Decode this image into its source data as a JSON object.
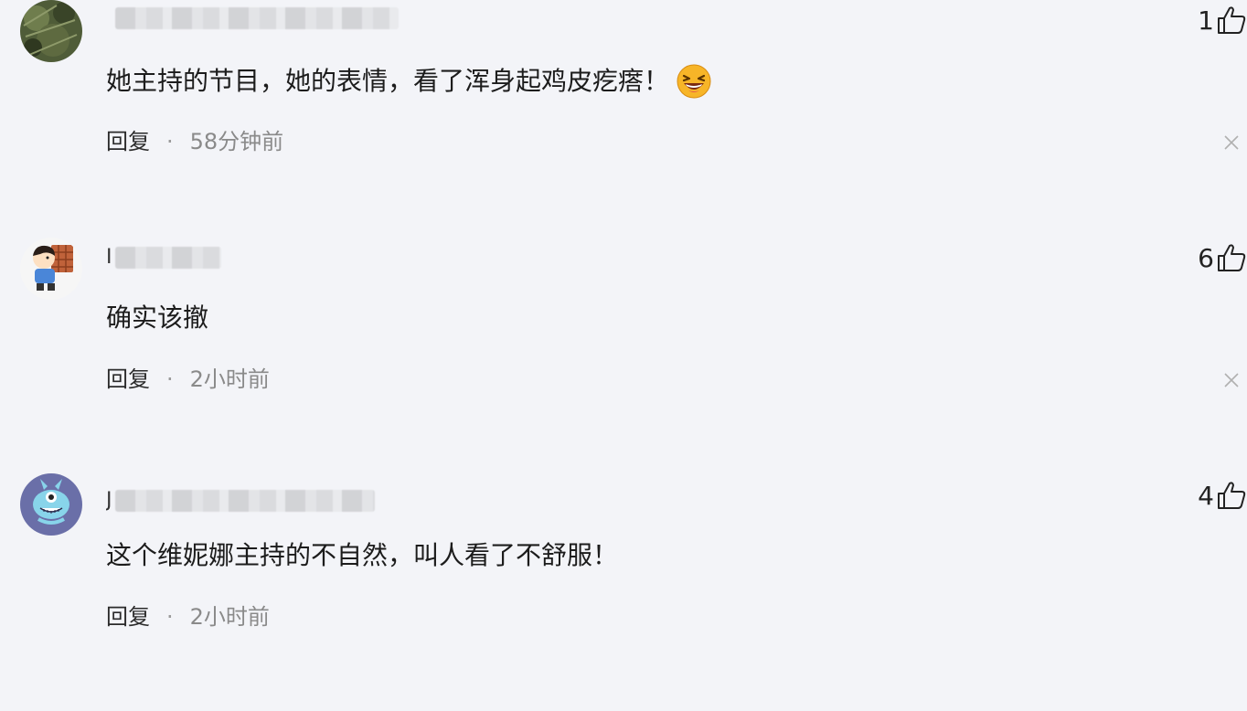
{
  "comments": [
    {
      "username_prefix": "",
      "text": "她主持的节目，她的表情，看了浑身起鸡皮疙瘩！",
      "emoji": "laughing-emoji",
      "reply_label": "回复",
      "separator": "·",
      "time": "58分钟前",
      "likes": "1"
    },
    {
      "username_prefix": "I",
      "text": "确实该撤",
      "reply_label": "回复",
      "separator": "·",
      "time": "2小时前",
      "likes": "6"
    },
    {
      "username_prefix": "J",
      "text": "这个维妮娜主持的不自然，叫人看了不舒服！",
      "reply_label": "回复",
      "separator": "·",
      "time": "2小时前",
      "likes": "4"
    }
  ],
  "icons": {
    "like": "thumbs-up-icon",
    "close": "close-icon"
  },
  "colors": {
    "background": "#f3f4f8",
    "text": "#1c1c1c",
    "muted": "#8a8a8a"
  }
}
